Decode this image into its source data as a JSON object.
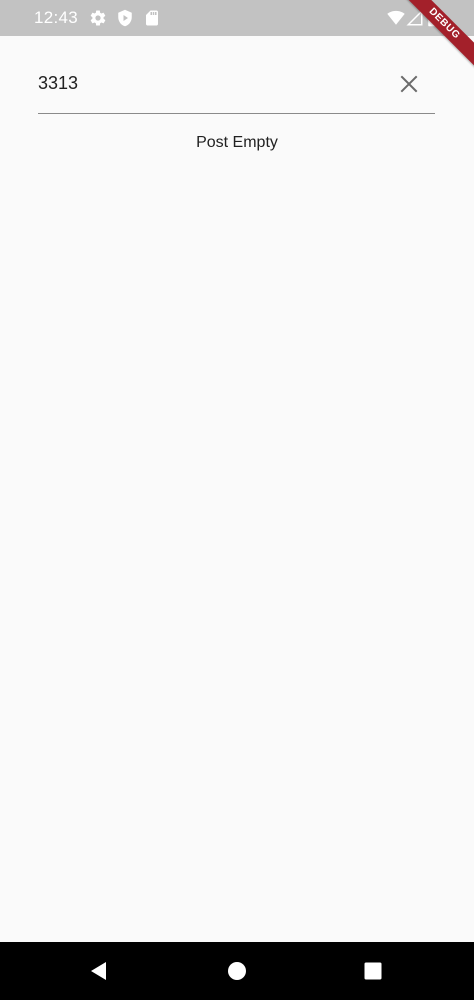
{
  "status_bar": {
    "time": "12:43",
    "left_icons": [
      "gear-icon",
      "shield-icon",
      "sd-card-icon"
    ],
    "right_icons": [
      "wifi-icon",
      "cell-signal-icon",
      "battery-icon"
    ]
  },
  "debug_banner": {
    "label": "DEBUG",
    "color": "#a3202a"
  },
  "search": {
    "value": "3313",
    "placeholder": "",
    "clear_icon": "close-icon"
  },
  "results": {
    "empty_message": "Post Empty"
  },
  "nav_bar": {
    "buttons": [
      "back-icon",
      "home-icon",
      "recents-icon"
    ]
  },
  "colors": {
    "status_bar_bg": "#c2c2c2",
    "page_bg": "#fafafa",
    "text": "#212121",
    "underline": "#8a8a8a",
    "nav_bar_bg": "#000000"
  }
}
